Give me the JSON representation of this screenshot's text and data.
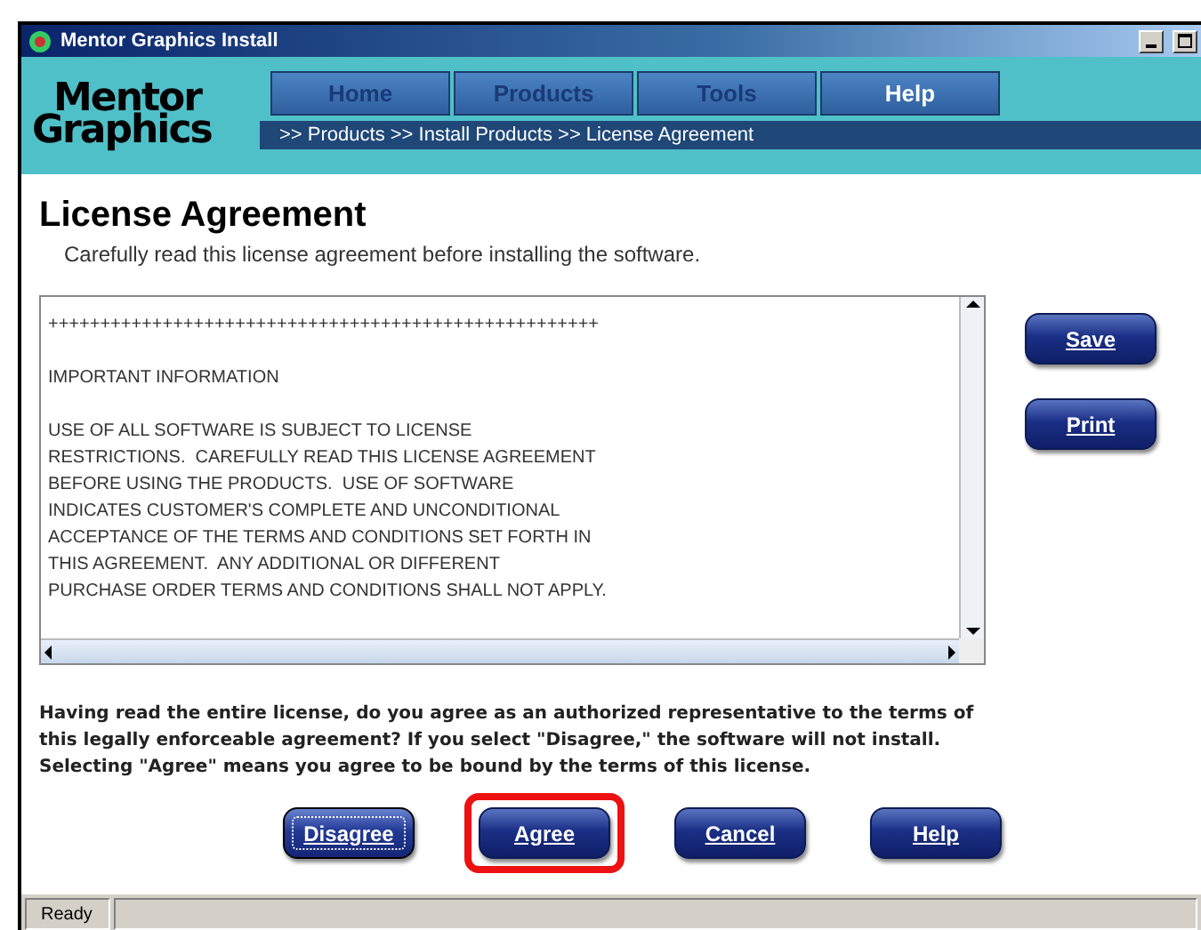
{
  "window": {
    "title": "Mentor Graphics Install"
  },
  "logo": [
    "Mentor",
    "Graphics"
  ],
  "nav": [
    {
      "label": "Home",
      "selected": false
    },
    {
      "label": "Products",
      "selected": false
    },
    {
      "label": "Tools",
      "selected": false
    },
    {
      "label": "Help",
      "selected": true
    }
  ],
  "breadcrumb": ">> Products >> Install Products >> License Agreement",
  "heading": "License Agreement",
  "subtitle": "Carefully read this license agreement before installing the software.",
  "license_text": [
    [
      "+++++++++++++++++++++++++++++++++++++++++++++++++++++"
    ],
    [
      "IMPORTANT INFORMATION"
    ],
    [
      "USE OF ALL SOFTWARE IS SUBJECT TO LICENSE",
      "RESTRICTIONS.  CAREFULLY READ THIS LICENSE AGREEMENT",
      "BEFORE USING THE PRODUCTS.  USE OF SOFTWARE",
      "INDICATES CUSTOMER'S COMPLETE AND UNCONDITIONAL",
      "ACCEPTANCE OF THE TERMS AND CONDITIONS SET FORTH IN",
      "THIS AGREEMENT.  ANY ADDITIONAL OR DIFFERENT",
      "PURCHASE ORDER TERMS AND CONDITIONS SHALL NOT APPLY."
    ]
  ],
  "side_buttons": [
    "Save",
    "Print"
  ],
  "question": [
    "Having read the entire license, do you agree as an authorized representative to the terms of",
    "this legally enforceable agreement?  If you select \"Disagree,\" the software will not install.",
    "Selecting \"Agree\" means you agree to be bound by the terms of this license."
  ],
  "buttons": [
    {
      "label": "Disagree",
      "focused": true,
      "highlighted": false
    },
    {
      "label": "Agree",
      "focused": false,
      "highlighted": true
    },
    {
      "label": "Cancel",
      "focused": false,
      "highlighted": false
    },
    {
      "label": "Help",
      "focused": false,
      "highlighted": false
    }
  ],
  "status_bar": {
    "text": "Ready"
  }
}
